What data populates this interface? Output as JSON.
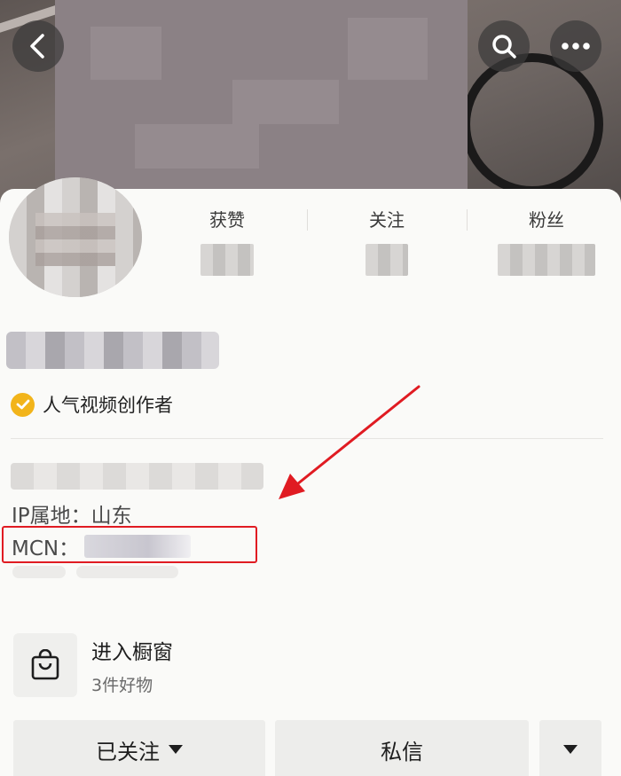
{
  "header": {
    "back_icon": "chevron-left-icon",
    "search_icon": "search-icon",
    "more_icon": "more-horizontal-icon"
  },
  "stats": [
    {
      "label": "获赞"
    },
    {
      "label": "关注"
    },
    {
      "label": "粉丝"
    }
  ],
  "profile": {
    "badge_icon": "verified-check-icon",
    "badge_text": "人气视频创作者",
    "ip_location": "IP属地：山东",
    "mcn_label": "MCN："
  },
  "annotation": {
    "highlight_color": "#e01b22"
  },
  "shop": {
    "icon": "shopping-bag-icon",
    "title": "进入橱窗",
    "subtitle": "3件好物"
  },
  "actions": {
    "follow_label": "已关注",
    "message_label": "私信"
  },
  "colors": {
    "badge": "#f2b41a",
    "button_bg": "#ededeb",
    "page_bg": "#fafaf8"
  }
}
